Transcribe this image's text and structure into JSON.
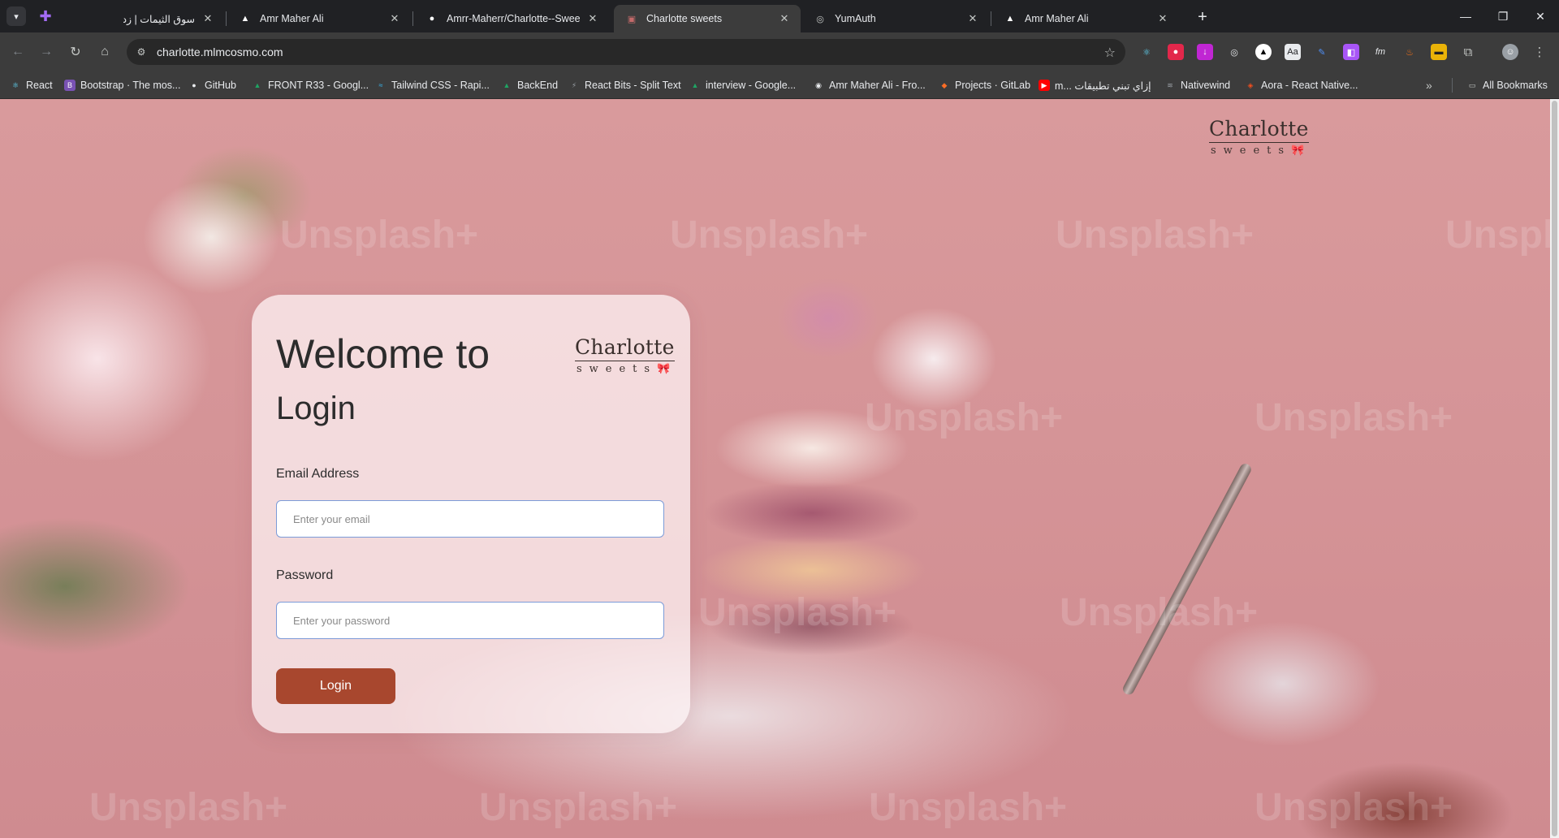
{
  "browser": {
    "tabs": [
      {
        "title": "سوق الثيمات | زد",
        "favicon": "zid-icon",
        "active": false
      },
      {
        "title": "Amr Maher Ali",
        "favicon": "vercel-icon",
        "active": false
      },
      {
        "title": "Amrr-Maherr/Charlotte--Sweet",
        "favicon": "github-icon",
        "active": false
      },
      {
        "title": "Charlotte sweets",
        "favicon": "site-icon",
        "active": true
      },
      {
        "title": "YumAuth",
        "favicon": "globe-icon",
        "active": false
      },
      {
        "title": "Amr Maher Ali",
        "favicon": "vercel-icon",
        "active": false
      }
    ],
    "address_bar": {
      "url": "charlotte.mlmcosmo.com"
    },
    "bookmarks": [
      {
        "label": "React",
        "icon": "react-icon",
        "color": "#61dafb"
      },
      {
        "label": "Bootstrap · The mos...",
        "icon": "bootstrap-icon",
        "color": "#7952b3"
      },
      {
        "label": "GitHub",
        "icon": "github-icon",
        "color": "#e8eaed"
      },
      {
        "label": "FRONT R33 - Googl...",
        "icon": "drive-icon",
        "color": "#1fa463"
      },
      {
        "label": "Tailwind CSS - Rapi...",
        "icon": "tailwind-icon",
        "color": "#38bdf8"
      },
      {
        "label": "BackEnd",
        "icon": "drive-icon",
        "color": "#1fa463"
      },
      {
        "label": "React Bits - Split Text",
        "icon": "reactbits-icon",
        "color": "#9aa0a6"
      },
      {
        "label": "interview - Google...",
        "icon": "drive-icon",
        "color": "#1fa463"
      },
      {
        "label": "Amr Maher Ali - Fro...",
        "icon": "globe-icon",
        "color": "#9aa0a6"
      },
      {
        "label": "Projects · GitLab",
        "icon": "gitlab-icon",
        "color": "#fc6d26"
      },
      {
        "label": "m... إزاي تبني تطبيقات",
        "icon": "youtube-icon",
        "color": "#ff0000"
      },
      {
        "label": "Nativewind",
        "icon": "nativewind-icon",
        "color": "#9aa0a6"
      },
      {
        "label": "Aora - React Native...",
        "icon": "figma-icon",
        "color": "#f24e1e"
      }
    ],
    "all_bookmarks_label": "All Bookmarks"
  },
  "page": {
    "brand": {
      "name": "Charlotte",
      "tagline": "sweets",
      "bow": "🎀"
    },
    "watermark_text": "Unsplash+",
    "login_card": {
      "title_line1": "Welcome to",
      "title_line2": "Login",
      "email_label": "Email Address",
      "email_placeholder": "Enter your email",
      "password_label": "Password",
      "password_placeholder": "Enter your password",
      "login_button": "Login"
    }
  },
  "colors": {
    "accent_button": "#a8472e",
    "input_border": "#7c9bd8",
    "background_pink": "#d59497"
  }
}
